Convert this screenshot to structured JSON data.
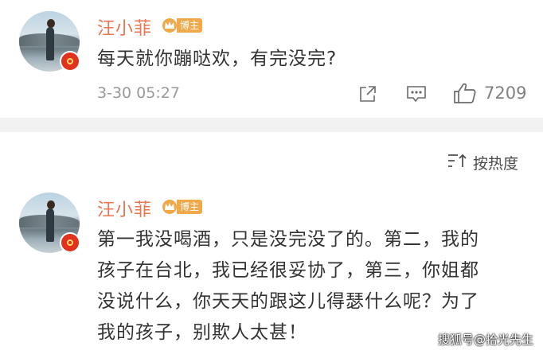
{
  "comment1": {
    "username": "汪小菲",
    "badge_label": "博主",
    "text": "每天就你蹦哒欢，有完没完?",
    "time": "3-30 05:27",
    "like_count": "7209"
  },
  "sort": {
    "label": "按热度"
  },
  "comment2": {
    "username": "汪小菲",
    "badge_label": "博主",
    "text_lines": [
      "第一我没喝酒，只是没完没了的。第二，我的",
      "孩子在台北，我已经很妥协了，第三，你姐都",
      "没说什么，你天天的跟这儿得瑟什么呢？为了",
      "我的孩子，别欺人太甚！"
    ]
  },
  "watermark": "搜狐号@拾光先生",
  "colors": {
    "username": "#eb7350",
    "badge": "#f0a94a",
    "verified": "#e1321e"
  }
}
